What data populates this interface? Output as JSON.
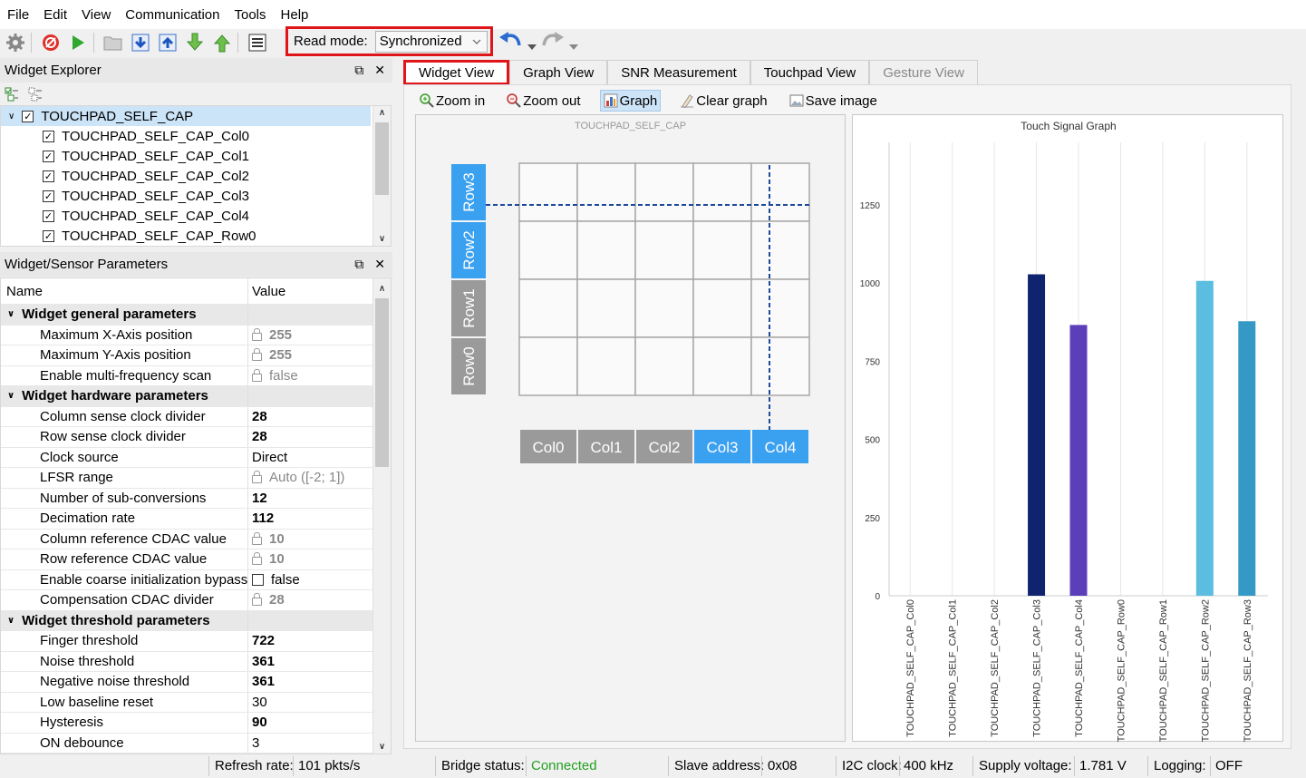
{
  "menu": [
    "File",
    "Edit",
    "View",
    "Communication",
    "Tools",
    "Help"
  ],
  "toolbar": {
    "read_mode_label": "Read mode:",
    "read_mode_value": "Synchronized"
  },
  "widget_explorer": {
    "title": "Widget Explorer",
    "items": [
      {
        "label": "TOUCHPAD_SELF_CAP",
        "checked": true,
        "selected": true
      },
      {
        "label": "TOUCHPAD_SELF_CAP_Col0",
        "checked": true
      },
      {
        "label": "TOUCHPAD_SELF_CAP_Col1",
        "checked": true
      },
      {
        "label": "TOUCHPAD_SELF_CAP_Col2",
        "checked": true
      },
      {
        "label": "TOUCHPAD_SELF_CAP_Col3",
        "checked": true
      },
      {
        "label": "TOUCHPAD_SELF_CAP_Col4",
        "checked": true
      },
      {
        "label": "TOUCHPAD_SELF_CAP_Row0",
        "checked": true
      }
    ]
  },
  "params": {
    "title": "Widget/Sensor Parameters",
    "col_name": "Name",
    "col_value": "Value",
    "rows": [
      {
        "type": "group",
        "name": "Widget general parameters"
      },
      {
        "name": "Maximum X-Axis position",
        "value": "255",
        "style": "locked-bold"
      },
      {
        "name": "Maximum Y-Axis position",
        "value": "255",
        "style": "locked-bold"
      },
      {
        "name": "Enable multi-frequency scan",
        "value": "false",
        "style": "locked"
      },
      {
        "type": "group",
        "name": "Widget hardware parameters"
      },
      {
        "name": "Column sense clock divider",
        "value": "28",
        "style": "bold"
      },
      {
        "name": "Row sense clock divider",
        "value": "28",
        "style": "bold"
      },
      {
        "name": "Clock source",
        "value": "Direct",
        "style": "normal"
      },
      {
        "name": "LFSR range",
        "value": "Auto ([-2; 1])",
        "style": "locked"
      },
      {
        "name": "Number of sub-conversions",
        "value": "12",
        "style": "bold"
      },
      {
        "name": "Decimation rate",
        "value": "112",
        "style": "bold"
      },
      {
        "name": "Column reference CDAC value",
        "value": "10",
        "style": "locked-bold"
      },
      {
        "name": "Row reference CDAC value",
        "value": "10",
        "style": "locked-bold"
      },
      {
        "name": "Enable coarse initialization bypass",
        "value": "false",
        "style": "checkbox"
      },
      {
        "name": "Compensation CDAC divider",
        "value": "28",
        "style": "locked-bold"
      },
      {
        "type": "group",
        "name": "Widget threshold parameters"
      },
      {
        "name": "Finger threshold",
        "value": "722",
        "style": "bold"
      },
      {
        "name": "Noise threshold",
        "value": "361",
        "style": "bold"
      },
      {
        "name": "Negative noise threshold",
        "value": "361",
        "style": "bold"
      },
      {
        "name": "Low baseline reset",
        "value": "30",
        "style": "normal"
      },
      {
        "name": "Hysteresis",
        "value": "90",
        "style": "bold"
      },
      {
        "name": "ON debounce",
        "value": "3",
        "style": "normal"
      }
    ]
  },
  "tabs": [
    {
      "label": "Widget View",
      "active": true
    },
    {
      "label": "Graph View"
    },
    {
      "label": "SNR Measurement"
    },
    {
      "label": "Touchpad View"
    },
    {
      "label": "Gesture View",
      "disabled": true
    }
  ],
  "subtoolbar": {
    "zoom_in": "Zoom in",
    "zoom_out": "Zoom out",
    "graph": "Graph",
    "clear_graph": "Clear graph",
    "save_image": "Save image"
  },
  "widget_view": {
    "title": "TOUCHPAD_SELF_CAP",
    "rows": [
      {
        "label": "Row3",
        "active": true
      },
      {
        "label": "Row2",
        "active": true
      },
      {
        "label": "Row1",
        "active": false
      },
      {
        "label": "Row0",
        "active": false
      }
    ],
    "cols": [
      {
        "label": "Col0",
        "active": false
      },
      {
        "label": "Col1",
        "active": false
      },
      {
        "label": "Col2",
        "active": false
      },
      {
        "label": "Col3",
        "active": true
      },
      {
        "label": "Col4",
        "active": true
      }
    ],
    "colors": {
      "active": "#3aa0f0",
      "inactive": "#9a9a9a"
    }
  },
  "chart_data": {
    "type": "bar",
    "title": "Touch Signal Graph",
    "categories": [
      "TOUCHPAD_SELF_CAP_Col0",
      "TOUCHPAD_SELF_CAP_Col1",
      "TOUCHPAD_SELF_CAP_Col2",
      "TOUCHPAD_SELF_CAP_Col3",
      "TOUCHPAD_SELF_CAP_Col4",
      "TOUCHPAD_SELF_CAP_Row0",
      "TOUCHPAD_SELF_CAP_Row1",
      "TOUCHPAD_SELF_CAP_Row2",
      "TOUCHPAD_SELF_CAP_Row3"
    ],
    "values": [
      0,
      0,
      0,
      1028,
      866,
      0,
      0,
      1007,
      878
    ],
    "colors": [
      "#000000",
      "#000000",
      "#000000",
      "#10236e",
      "#5a3fb8",
      "#000000",
      "#000000",
      "#5bbde0",
      "#3499c4"
    ],
    "yticks": [
      0,
      250,
      500,
      750,
      1000,
      1250
    ],
    "ylim": [
      0,
      1450
    ],
    "grid": true
  },
  "status": {
    "refresh_label": "Refresh rate:",
    "refresh_value": "101 pkts/s",
    "bridge_label": "Bridge status:",
    "bridge_value": "Connected",
    "slave_label": "Slave address:",
    "slave_value": "0x08",
    "i2c_label": "I2C clock:",
    "i2c_value": "400 kHz",
    "supply_label": "Supply voltage:",
    "supply_value": "1.781 V",
    "logging_label": "Logging:",
    "logging_value": "OFF"
  }
}
